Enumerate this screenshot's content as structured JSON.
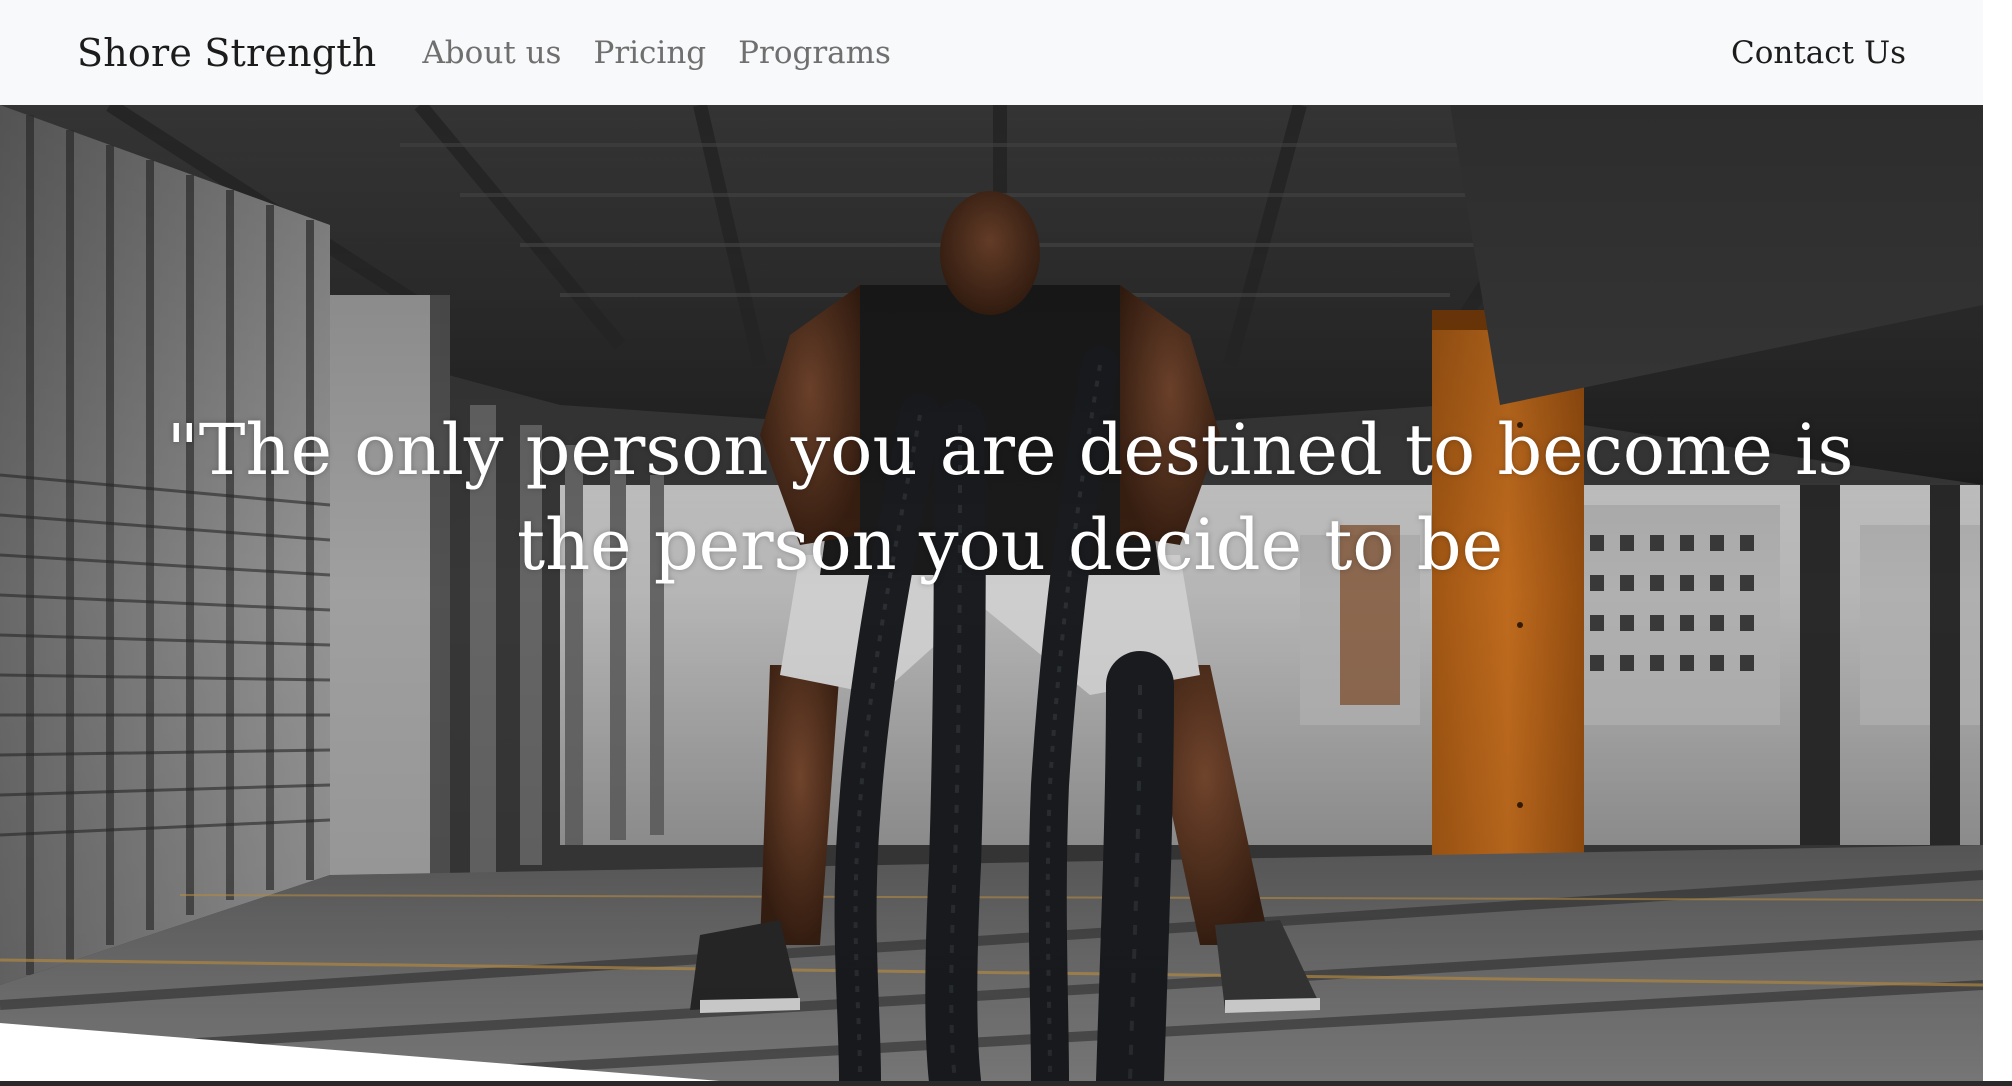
{
  "navbar": {
    "brand": "Shore Strength",
    "links": [
      {
        "label": "About us"
      },
      {
        "label": "Pricing"
      },
      {
        "label": "Programs"
      }
    ],
    "contact_label": "Contact Us"
  },
  "hero": {
    "quote": "\"The only person you are destined to become is the person you decide to be"
  },
  "colors": {
    "navbar_bg": "#f8f9fa",
    "pillar_orange": "#c8701f",
    "quote_text": "#ffffff"
  }
}
